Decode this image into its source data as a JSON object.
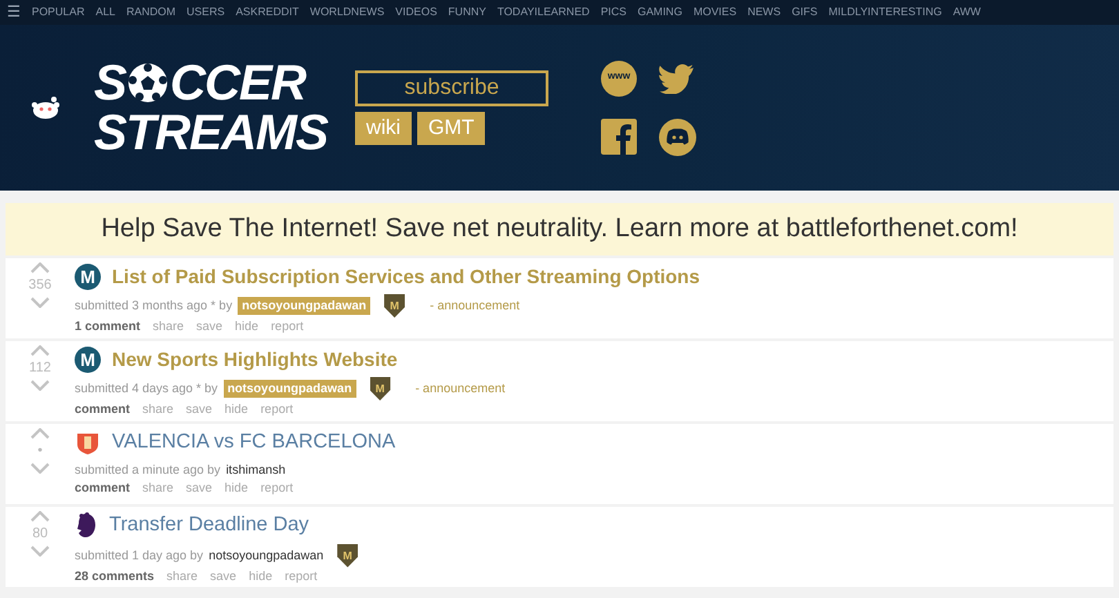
{
  "top_nav": {
    "menu_icon": "☰",
    "links": [
      "POPULAR",
      "ALL",
      "RANDOM",
      "USERS",
      "ASKREDDIT",
      "WORLDNEWS",
      "VIDEOS",
      "FUNNY",
      "TODAYILEARNED",
      "PICS",
      "GAMING",
      "MOVIES",
      "NEWS",
      "GIFS",
      "MILDLYINTERESTING",
      "AWW"
    ]
  },
  "header": {
    "logo": {
      "before_ball": "S",
      "after_ball": "CCER",
      "line2": "STREAMS"
    },
    "subscribe": "subscribe",
    "buttons": [
      "wiki",
      "GMT"
    ],
    "web_icon_text": "www"
  },
  "banner": "Help Save The Internet! Save net neutrality. Learn more at battleforthenet.com!",
  "posts": [
    {
      "kind": "announcement",
      "icon_letter": "M",
      "score": "356",
      "title": "List of Paid Subscription Services and Other Streaming Options",
      "submitted": "submitted 3 months ago * by",
      "author": "notsoyoungpadawan",
      "flair": "M",
      "tag": "- announcement",
      "comments": "1 comment",
      "actions": [
        "share",
        "save",
        "hide",
        "report"
      ]
    },
    {
      "kind": "announcement",
      "icon_letter": "M",
      "score": "112",
      "title": "New Sports Highlights Website",
      "submitted": "submitted 4 days ago * by",
      "author": "notsoyoungpadawan",
      "flair": "M",
      "tag": "- announcement",
      "comments": "comment",
      "actions": [
        "share",
        "save",
        "hide",
        "report"
      ]
    },
    {
      "kind": "normal",
      "score": "•",
      "title": "VALENCIA vs FC BARCELONA",
      "submitted": "submitted a minute ago by",
      "author": "itshimansh",
      "comments": "comment",
      "actions": [
        "share",
        "save",
        "hide",
        "report"
      ]
    },
    {
      "kind": "normal",
      "score": "80",
      "title": "Transfer Deadline Day",
      "submitted": "submitted 1 day ago by",
      "author": "notsoyoungpadawan",
      "flair": "M",
      "comments": "28 comments",
      "actions": [
        "share",
        "save",
        "hide",
        "report"
      ]
    }
  ]
}
